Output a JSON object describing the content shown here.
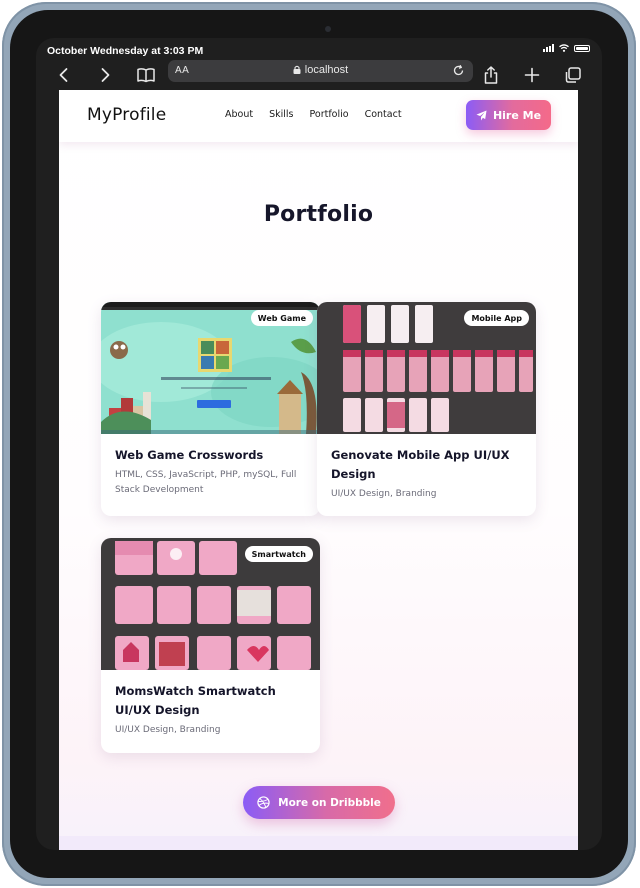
{
  "status_bar": {
    "time": "October Wednesday at 3:03 PM"
  },
  "browser": {
    "url": "localhost",
    "text_size_label": "AA",
    "icons": [
      "back-icon",
      "forward-icon",
      "bookmarks-icon",
      "lock-icon",
      "reload-icon",
      "share-icon",
      "new-tab-icon",
      "tabs-icon"
    ]
  },
  "nav": {
    "logo": "MyProfile",
    "links": [
      "About",
      "Skills",
      "Portfolio",
      "Contact"
    ],
    "cta": "Hire Me"
  },
  "portfolio": {
    "title": "Portfolio",
    "cards": [
      {
        "badge": "Web Game",
        "title": "Web Game Crosswords",
        "subtitle": "HTML, CSS, JavaScript, PHP, mySQL, Full Stack Development"
      },
      {
        "badge": "Mobile App",
        "title": "Genovate Mobile App UI/UX Design",
        "subtitle": "UI/UX Design, Branding"
      },
      {
        "badge": "Smartwatch",
        "title": "MomsWatch Smartwatch UI/UX Design",
        "subtitle": "UI/UX Design, Branding"
      }
    ],
    "more_button": "More on Dribbble"
  },
  "colors": {
    "accent_start": "#8b5cf6",
    "accent_end": "#f46a89",
    "title": "#16162a",
    "device_frame": "#93a6b8"
  }
}
